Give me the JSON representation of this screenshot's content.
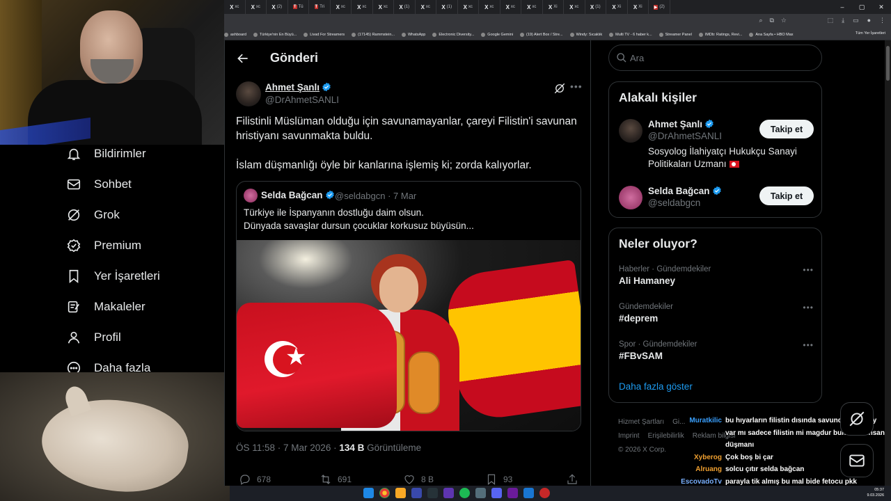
{
  "browser": {
    "tabs": [
      {
        "icon": "X",
        "label": "xc"
      },
      {
        "icon": "X",
        "label": "xc"
      },
      {
        "icon": "X",
        "label": "(2)"
      },
      {
        "icon": "T",
        "label": "Tü",
        "red": true
      },
      {
        "icon": "T",
        "label": "Tri",
        "red": true
      },
      {
        "icon": "X",
        "label": "xc"
      },
      {
        "icon": "X",
        "label": "xc"
      },
      {
        "icon": "X",
        "label": "xc"
      },
      {
        "icon": "X",
        "label": "(1)"
      },
      {
        "icon": "X",
        "label": "xc"
      },
      {
        "icon": "X",
        "label": "(1)"
      },
      {
        "icon": "X",
        "label": "xc"
      },
      {
        "icon": "X",
        "label": "xc"
      },
      {
        "icon": "X",
        "label": "xc"
      },
      {
        "icon": "X",
        "label": "xc"
      },
      {
        "icon": "X",
        "label": "Xi"
      },
      {
        "icon": "X",
        "label": "xc"
      },
      {
        "icon": "X",
        "label": "(1)"
      },
      {
        "icon": "X",
        "label": "Xi"
      },
      {
        "icon": "X",
        "label": "Xi"
      },
      {
        "icon": "▶",
        "label": "(2)",
        "red": true
      }
    ],
    "bookmarks": [
      "ashboard",
      "Türkiye'nin En Büyü...",
      "Livad For Streamers",
      "(17145) Rammstein...",
      "WhatsApp",
      "Electronic Diversity...",
      "Google Gemini",
      "(19) Alert Box / Stre...",
      "Windy: Sıcaklık",
      "Multi TV - 6 haber k...",
      "Streamer Panel",
      "IMDb: Ratings, Revi...",
      "Ana Sayfa • HBO Max"
    ],
    "all_bookmarks": "Tüm Yer İşaretleri"
  },
  "nav": {
    "items": [
      {
        "label": "Bildirimler",
        "icon": "bell-icon"
      },
      {
        "label": "Sohbet",
        "icon": "mail-icon"
      },
      {
        "label": "Grok",
        "icon": "grok-icon"
      },
      {
        "label": "Premium",
        "icon": "premium-icon"
      },
      {
        "label": "Yer İşaretleri",
        "icon": "bookmark-icon"
      },
      {
        "label": "Makaleler",
        "icon": "article-icon"
      },
      {
        "label": "Profil",
        "icon": "profile-icon"
      },
      {
        "label": "Daha fazla",
        "icon": "more-circle-icon"
      }
    ]
  },
  "post": {
    "header_title": "Gönderi",
    "author_name": "Ahmet Şanlı",
    "author_handle": "@DrAhmetSANLI",
    "text_p1": "Filistinli Müslüman olduğu için savunamayanlar, çareyi Filistin'i savunan hristiyanı savunmakta buldu.",
    "text_p2": "İslam düşmanlığı öyle bir kanlarına işlemiş ki; zorda kalıyorlar.",
    "quote": {
      "name": "Selda Bağcan",
      "handle_date": "@seldabgcn · 7 Mar",
      "line1": "Türkiye ile İspanyanın dostluğu daim olsun.",
      "line2": "Dünyada  savaşlar dursun çocuklar korkusuz büyüsün..."
    },
    "time": "ÖS 11:58 · 7 Mar 2026 · ",
    "views": "134 B",
    "views_label": " Görüntüleme",
    "actions": {
      "replies": "678",
      "reposts": "691",
      "likes": "8 B",
      "bookmarks": "93"
    }
  },
  "sidebar": {
    "search_placeholder": "Ara",
    "related_title": "Alakalı kişiler",
    "related": [
      {
        "name": "Ahmet Şanlı",
        "handle": "@DrAhmetSANLI",
        "bio": "Sosyolog İlahiyatçı Hukukçu Sanayi Politikaları Uzmanı",
        "button": "Takip et"
      },
      {
        "name": "Selda Bağcan",
        "handle": "@seldabgcn",
        "button": "Takip et"
      }
    ],
    "trends_title": "Neler oluyor?",
    "trends": [
      {
        "category": "Haberler · Gündemdekiler",
        "title": "Ali Hamaney"
      },
      {
        "category": "Gündemdekiler",
        "title": "#deprem"
      },
      {
        "category": "Spor · Gündemdekiler",
        "title": "#FBvSAM"
      }
    ],
    "show_more": "Daha fazla göster",
    "footer": [
      "Hizmet Şartları",
      "Gi...",
      "Imprint",
      "Erişilebilirlik",
      "Reklam bilgisi",
      "© 2026 X Corp."
    ]
  },
  "chat": [
    {
      "user": "Muratkilic",
      "color": "#3aa0ff",
      "msg": "bu hıyarların filistin dısında savunduğu bi şey var mı sadece filistin mi magdur bunlar da insan düşmanı"
    },
    {
      "user": "Xyberog",
      "color": "#f0a030",
      "msg": "Çok boş bi çar"
    },
    {
      "user": "Alruang",
      "color": "#f0a030",
      "msg": "solcu çıtır selda bağcan"
    },
    {
      "user": "EscovadoTv",
      "color": "#7ab0ff",
      "msg": "parayla tik almış bu mal bide fetocu pkk destekcisi hepsi ahmet şanlı gibi işte"
    }
  ],
  "taskbar": {
    "time": "05:37",
    "date": "9.03.2026"
  },
  "colors": {
    "accent": "#1d9bf0",
    "verified": "#1d9bf0",
    "background": "#000000"
  }
}
